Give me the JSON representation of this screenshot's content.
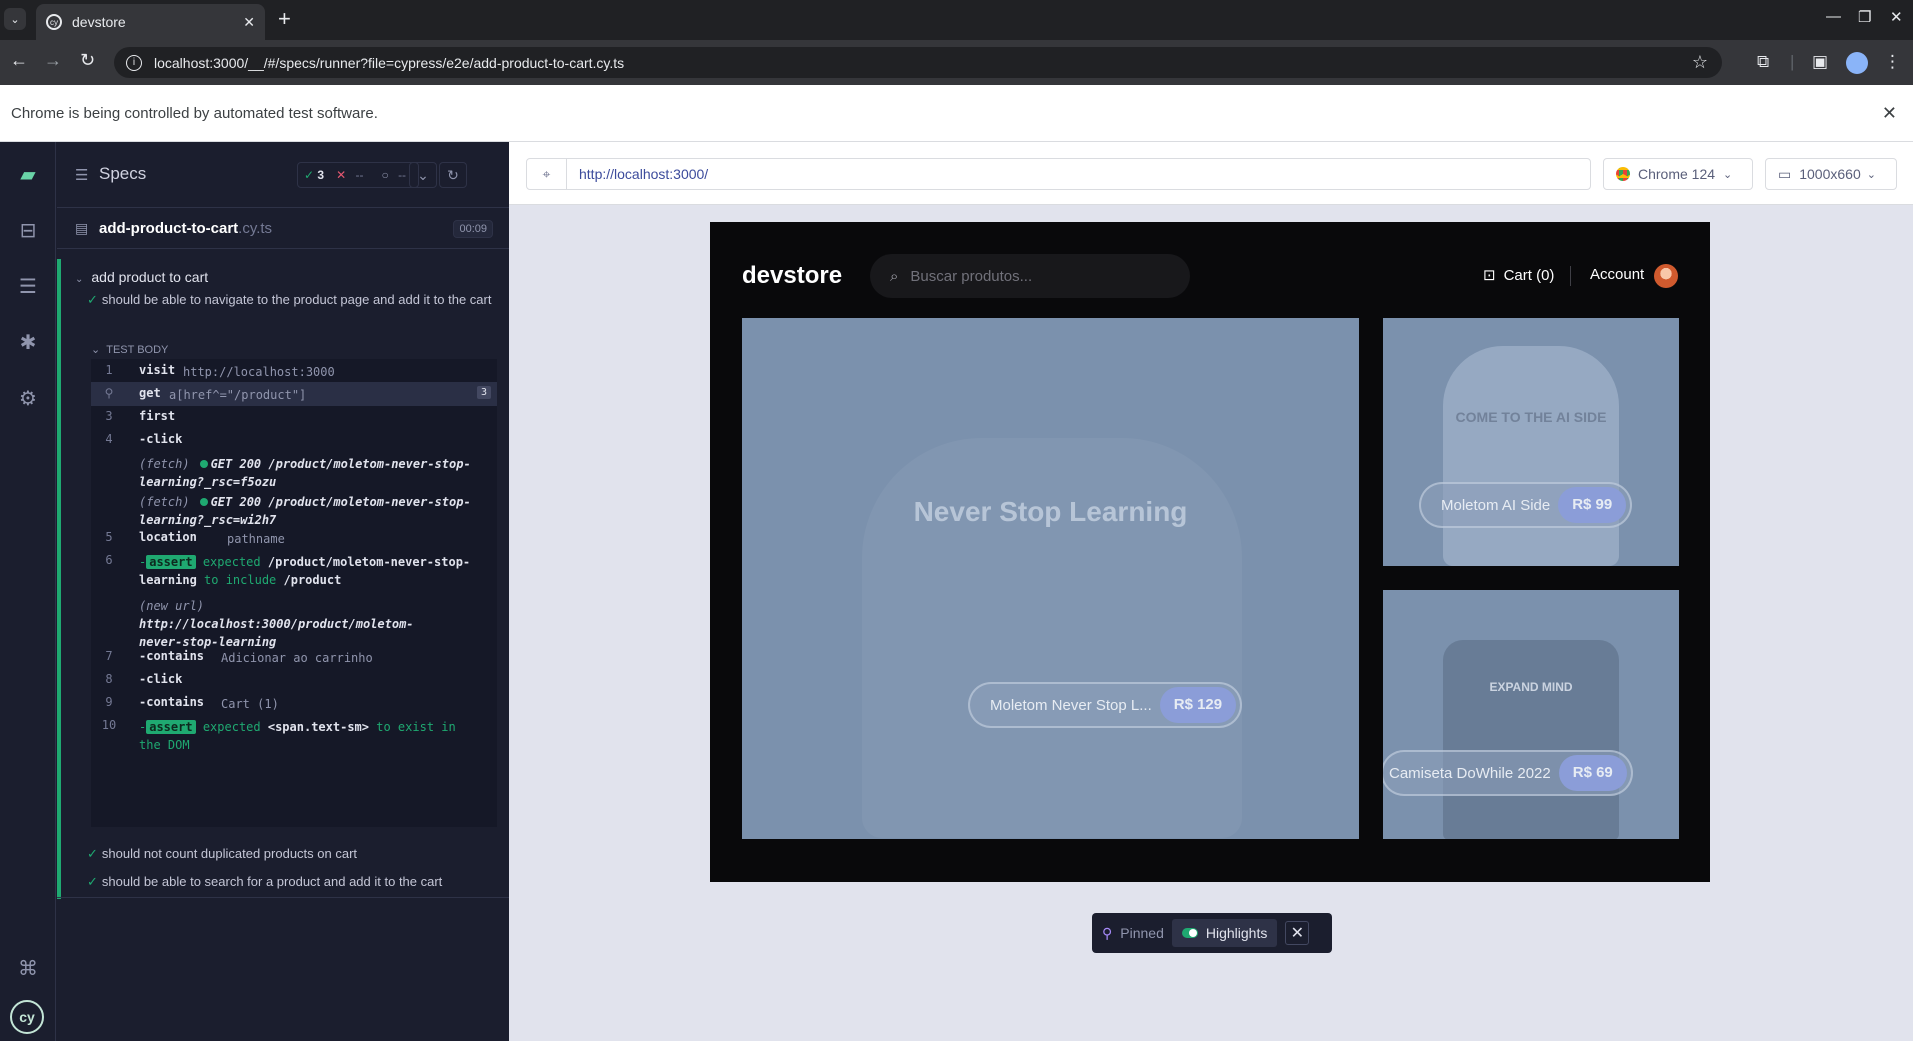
{
  "browser": {
    "tab_title": "devstore",
    "url": "localhost:3000/__/#/specs/runner?file=cypress/e2e/add-product-to-cart.cy.ts",
    "infobar_text": "Chrome is being controlled by automated test software."
  },
  "reporter": {
    "specs_label": "Specs",
    "stats": {
      "passed": "3",
      "failed": "--",
      "pending": "--"
    },
    "spec_file": {
      "name": "add-product-to-cart",
      "ext": ".cy.ts",
      "duration": "00:09"
    },
    "suite_title": "add product to cart",
    "test1_title": "should be able to navigate to the product page and add it to the cart",
    "test_body_label": "TEST BODY",
    "commands": {
      "c1": {
        "num": "1",
        "name": "visit",
        "msg": "http://localhost:3000"
      },
      "c2": {
        "name": "get",
        "msg": "a[href^=\"/product\"]",
        "badge": "3"
      },
      "c3": {
        "num": "3",
        "name": "first"
      },
      "c4": {
        "num": "4",
        "name": "-click"
      },
      "f1": {
        "prefix": "(fetch)",
        "text": "GET 200 /product/moletom-never-stop-learning?_rsc=f5ozu"
      },
      "f2": {
        "prefix": "(fetch)",
        "text": "GET 200 /product/moletom-never-stop-learning?_rsc=wi2h7"
      },
      "c5": {
        "num": "5",
        "name": "location",
        "msg": "pathname"
      },
      "c6": {
        "num": "6",
        "dash": "-",
        "tag": "assert",
        "msg_a": "expected ",
        "msg_b": "/product/moletom-never-stop-learning",
        "msg_c": " to include ",
        "msg_d": "/product"
      },
      "nu": {
        "prefix": "(new url)",
        "text": "http://localhost:3000/product/moletom-never-stop-learning"
      },
      "c7": {
        "num": "7",
        "name": "-contains",
        "msg": "Adicionar ao carrinho"
      },
      "c8": {
        "num": "8",
        "name": "-click"
      },
      "c9": {
        "num": "9",
        "name": "-contains",
        "msg": "Cart (1)"
      },
      "c10": {
        "num": "10",
        "dash": "-",
        "tag": "assert",
        "msg_a": "expected ",
        "msg_b": "<span.text-sm>",
        "msg_c": " to exist in the DOM"
      }
    },
    "test2_title": "should not count duplicated products on cart",
    "test3_title": "should be able to search for a product and add it to the cart"
  },
  "aut": {
    "url": "http://localhost:3000/",
    "browser": "Chrome 124",
    "viewport": "1000x660"
  },
  "app": {
    "logo": "devstore",
    "search_placeholder": "Buscar produtos...",
    "cart": "Cart (0)",
    "account": "Account",
    "products": [
      {
        "name": "Moletom Never Stop L...",
        "price": "R$ 129",
        "print": "Never Stop Learning"
      },
      {
        "name": "Moletom AI Side",
        "price": "R$ 99",
        "print": "COME TO THE AI SIDE"
      },
      {
        "name": "Camiseta DoWhile 2022",
        "price": "R$ 69",
        "print": "EXPAND MIND"
      }
    ]
  },
  "pinned_bar": {
    "label": "Pinned",
    "highlights": "Highlights"
  },
  "colors": {
    "pass": "#1fa971",
    "fail": "#e45770",
    "accent": "#8b9dd8"
  }
}
